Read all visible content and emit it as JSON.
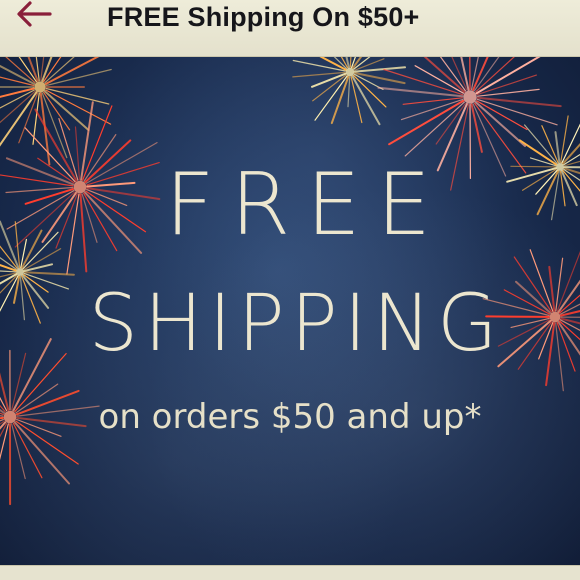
{
  "header": {
    "title": "FREE Shipping On $50+",
    "back_icon": "back-arrow-icon",
    "accent_color": "#8a1f3a"
  },
  "banner": {
    "headline_line1": "FREE",
    "headline_line2": "SHIPPING",
    "subtext": "on orders $50 and up*",
    "background_color": "#1c2f55",
    "text_color": "#ece6cf"
  }
}
